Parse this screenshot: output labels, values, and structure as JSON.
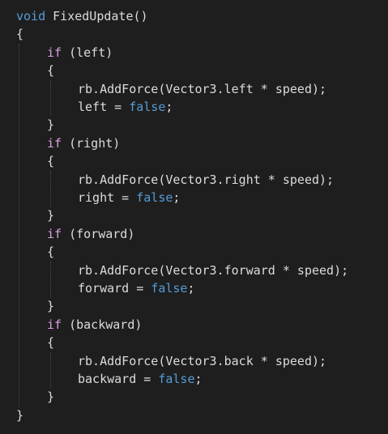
{
  "colors": {
    "background": "#1e1e1e",
    "plain": "#dcdcdc",
    "keyword": "#569cd6",
    "control": "#d8a0df"
  },
  "code": {
    "lines": [
      {
        "indent": 0,
        "tokens": [
          {
            "t": "void",
            "k": "keyword"
          },
          {
            "t": " FixedUpdate()",
            "k": "plain"
          }
        ]
      },
      {
        "indent": 0,
        "tokens": [
          {
            "t": "{",
            "k": "plain"
          }
        ]
      },
      {
        "indent": 1,
        "tokens": [
          {
            "t": "if",
            "k": "control"
          },
          {
            "t": " (left)",
            "k": "plain"
          }
        ]
      },
      {
        "indent": 1,
        "tokens": [
          {
            "t": "{",
            "k": "plain"
          }
        ]
      },
      {
        "indent": 2,
        "tokens": [
          {
            "t": "rb.AddForce(Vector3.left * speed);",
            "k": "plain"
          }
        ]
      },
      {
        "indent": 2,
        "tokens": [
          {
            "t": "left = ",
            "k": "plain"
          },
          {
            "t": "false",
            "k": "keyword"
          },
          {
            "t": ";",
            "k": "plain"
          }
        ]
      },
      {
        "indent": 1,
        "tokens": [
          {
            "t": "}",
            "k": "plain"
          }
        ]
      },
      {
        "indent": 1,
        "tokens": [
          {
            "t": "if",
            "k": "control"
          },
          {
            "t": " (right)",
            "k": "plain"
          }
        ]
      },
      {
        "indent": 1,
        "tokens": [
          {
            "t": "{",
            "k": "plain"
          }
        ]
      },
      {
        "indent": 2,
        "tokens": [
          {
            "t": "rb.AddForce(Vector3.right * speed);",
            "k": "plain"
          }
        ]
      },
      {
        "indent": 2,
        "tokens": [
          {
            "t": "right = ",
            "k": "plain"
          },
          {
            "t": "false",
            "k": "keyword"
          },
          {
            "t": ";",
            "k": "plain"
          }
        ]
      },
      {
        "indent": 1,
        "tokens": [
          {
            "t": "}",
            "k": "plain"
          }
        ]
      },
      {
        "indent": 1,
        "tokens": [
          {
            "t": "if",
            "k": "control"
          },
          {
            "t": " (forward)",
            "k": "plain"
          }
        ]
      },
      {
        "indent": 1,
        "tokens": [
          {
            "t": "{",
            "k": "plain"
          }
        ]
      },
      {
        "indent": 2,
        "tokens": [
          {
            "t": "rb.AddForce(Vector3.forward * speed);",
            "k": "plain"
          }
        ]
      },
      {
        "indent": 2,
        "tokens": [
          {
            "t": "forward = ",
            "k": "plain"
          },
          {
            "t": "false",
            "k": "keyword"
          },
          {
            "t": ";",
            "k": "plain"
          }
        ]
      },
      {
        "indent": 1,
        "tokens": [
          {
            "t": "}",
            "k": "plain"
          }
        ]
      },
      {
        "indent": 1,
        "tokens": [
          {
            "t": "if",
            "k": "control"
          },
          {
            "t": " (backward)",
            "k": "plain"
          }
        ]
      },
      {
        "indent": 1,
        "tokens": [
          {
            "t": "{",
            "k": "plain"
          }
        ]
      },
      {
        "indent": 2,
        "tokens": [
          {
            "t": "rb.AddForce(Vector3.back * speed);",
            "k": "plain"
          }
        ]
      },
      {
        "indent": 2,
        "tokens": [
          {
            "t": "backward = ",
            "k": "plain"
          },
          {
            "t": "false",
            "k": "keyword"
          },
          {
            "t": ";",
            "k": "plain"
          }
        ]
      },
      {
        "indent": 1,
        "tokens": [
          {
            "t": "}",
            "k": "plain"
          }
        ]
      },
      {
        "indent": 0,
        "tokens": [
          {
            "t": "}",
            "k": "plain"
          }
        ]
      }
    ]
  }
}
